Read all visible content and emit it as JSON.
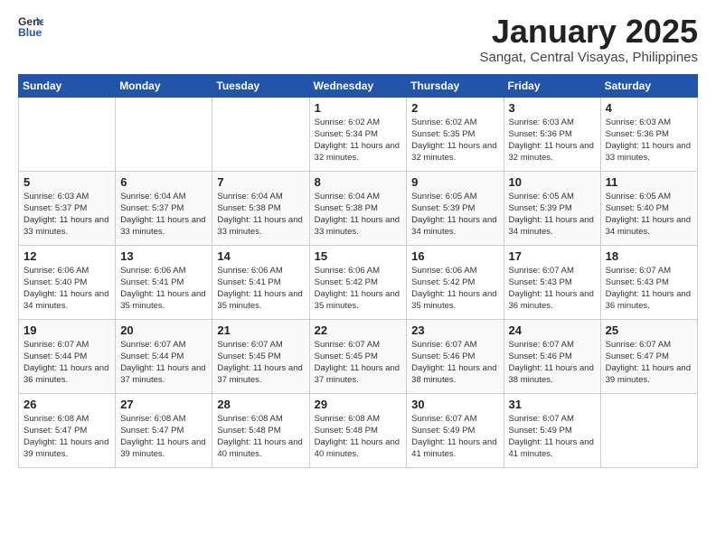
{
  "header": {
    "logo_general": "General",
    "logo_blue": "Blue",
    "month_title": "January 2025",
    "location": "Sangat, Central Visayas, Philippines"
  },
  "weekdays": [
    "Sunday",
    "Monday",
    "Tuesday",
    "Wednesday",
    "Thursday",
    "Friday",
    "Saturday"
  ],
  "weeks": [
    [
      {
        "day": "",
        "sunrise": "",
        "sunset": "",
        "daylight": ""
      },
      {
        "day": "",
        "sunrise": "",
        "sunset": "",
        "daylight": ""
      },
      {
        "day": "",
        "sunrise": "",
        "sunset": "",
        "daylight": ""
      },
      {
        "day": "1",
        "sunrise": "Sunrise: 6:02 AM",
        "sunset": "Sunset: 5:34 PM",
        "daylight": "Daylight: 11 hours and 32 minutes."
      },
      {
        "day": "2",
        "sunrise": "Sunrise: 6:02 AM",
        "sunset": "Sunset: 5:35 PM",
        "daylight": "Daylight: 11 hours and 32 minutes."
      },
      {
        "day": "3",
        "sunrise": "Sunrise: 6:03 AM",
        "sunset": "Sunset: 5:36 PM",
        "daylight": "Daylight: 11 hours and 32 minutes."
      },
      {
        "day": "4",
        "sunrise": "Sunrise: 6:03 AM",
        "sunset": "Sunset: 5:36 PM",
        "daylight": "Daylight: 11 hours and 33 minutes."
      }
    ],
    [
      {
        "day": "5",
        "sunrise": "Sunrise: 6:03 AM",
        "sunset": "Sunset: 5:37 PM",
        "daylight": "Daylight: 11 hours and 33 minutes."
      },
      {
        "day": "6",
        "sunrise": "Sunrise: 6:04 AM",
        "sunset": "Sunset: 5:37 PM",
        "daylight": "Daylight: 11 hours and 33 minutes."
      },
      {
        "day": "7",
        "sunrise": "Sunrise: 6:04 AM",
        "sunset": "Sunset: 5:38 PM",
        "daylight": "Daylight: 11 hours and 33 minutes."
      },
      {
        "day": "8",
        "sunrise": "Sunrise: 6:04 AM",
        "sunset": "Sunset: 5:38 PM",
        "daylight": "Daylight: 11 hours and 33 minutes."
      },
      {
        "day": "9",
        "sunrise": "Sunrise: 6:05 AM",
        "sunset": "Sunset: 5:39 PM",
        "daylight": "Daylight: 11 hours and 34 minutes."
      },
      {
        "day": "10",
        "sunrise": "Sunrise: 6:05 AM",
        "sunset": "Sunset: 5:39 PM",
        "daylight": "Daylight: 11 hours and 34 minutes."
      },
      {
        "day": "11",
        "sunrise": "Sunrise: 6:05 AM",
        "sunset": "Sunset: 5:40 PM",
        "daylight": "Daylight: 11 hours and 34 minutes."
      }
    ],
    [
      {
        "day": "12",
        "sunrise": "Sunrise: 6:06 AM",
        "sunset": "Sunset: 5:40 PM",
        "daylight": "Daylight: 11 hours and 34 minutes."
      },
      {
        "day": "13",
        "sunrise": "Sunrise: 6:06 AM",
        "sunset": "Sunset: 5:41 PM",
        "daylight": "Daylight: 11 hours and 35 minutes."
      },
      {
        "day": "14",
        "sunrise": "Sunrise: 6:06 AM",
        "sunset": "Sunset: 5:41 PM",
        "daylight": "Daylight: 11 hours and 35 minutes."
      },
      {
        "day": "15",
        "sunrise": "Sunrise: 6:06 AM",
        "sunset": "Sunset: 5:42 PM",
        "daylight": "Daylight: 11 hours and 35 minutes."
      },
      {
        "day": "16",
        "sunrise": "Sunrise: 6:06 AM",
        "sunset": "Sunset: 5:42 PM",
        "daylight": "Daylight: 11 hours and 35 minutes."
      },
      {
        "day": "17",
        "sunrise": "Sunrise: 6:07 AM",
        "sunset": "Sunset: 5:43 PM",
        "daylight": "Daylight: 11 hours and 36 minutes."
      },
      {
        "day": "18",
        "sunrise": "Sunrise: 6:07 AM",
        "sunset": "Sunset: 5:43 PM",
        "daylight": "Daylight: 11 hours and 36 minutes."
      }
    ],
    [
      {
        "day": "19",
        "sunrise": "Sunrise: 6:07 AM",
        "sunset": "Sunset: 5:44 PM",
        "daylight": "Daylight: 11 hours and 36 minutes."
      },
      {
        "day": "20",
        "sunrise": "Sunrise: 6:07 AM",
        "sunset": "Sunset: 5:44 PM",
        "daylight": "Daylight: 11 hours and 37 minutes."
      },
      {
        "day": "21",
        "sunrise": "Sunrise: 6:07 AM",
        "sunset": "Sunset: 5:45 PM",
        "daylight": "Daylight: 11 hours and 37 minutes."
      },
      {
        "day": "22",
        "sunrise": "Sunrise: 6:07 AM",
        "sunset": "Sunset: 5:45 PM",
        "daylight": "Daylight: 11 hours and 37 minutes."
      },
      {
        "day": "23",
        "sunrise": "Sunrise: 6:07 AM",
        "sunset": "Sunset: 5:46 PM",
        "daylight": "Daylight: 11 hours and 38 minutes."
      },
      {
        "day": "24",
        "sunrise": "Sunrise: 6:07 AM",
        "sunset": "Sunset: 5:46 PM",
        "daylight": "Daylight: 11 hours and 38 minutes."
      },
      {
        "day": "25",
        "sunrise": "Sunrise: 6:07 AM",
        "sunset": "Sunset: 5:47 PM",
        "daylight": "Daylight: 11 hours and 39 minutes."
      }
    ],
    [
      {
        "day": "26",
        "sunrise": "Sunrise: 6:08 AM",
        "sunset": "Sunset: 5:47 PM",
        "daylight": "Daylight: 11 hours and 39 minutes."
      },
      {
        "day": "27",
        "sunrise": "Sunrise: 6:08 AM",
        "sunset": "Sunset: 5:47 PM",
        "daylight": "Daylight: 11 hours and 39 minutes."
      },
      {
        "day": "28",
        "sunrise": "Sunrise: 6:08 AM",
        "sunset": "Sunset: 5:48 PM",
        "daylight": "Daylight: 11 hours and 40 minutes."
      },
      {
        "day": "29",
        "sunrise": "Sunrise: 6:08 AM",
        "sunset": "Sunset: 5:48 PM",
        "daylight": "Daylight: 11 hours and 40 minutes."
      },
      {
        "day": "30",
        "sunrise": "Sunrise: 6:07 AM",
        "sunset": "Sunset: 5:49 PM",
        "daylight": "Daylight: 11 hours and 41 minutes."
      },
      {
        "day": "31",
        "sunrise": "Sunrise: 6:07 AM",
        "sunset": "Sunset: 5:49 PM",
        "daylight": "Daylight: 11 hours and 41 minutes."
      },
      {
        "day": "",
        "sunrise": "",
        "sunset": "",
        "daylight": ""
      }
    ]
  ]
}
